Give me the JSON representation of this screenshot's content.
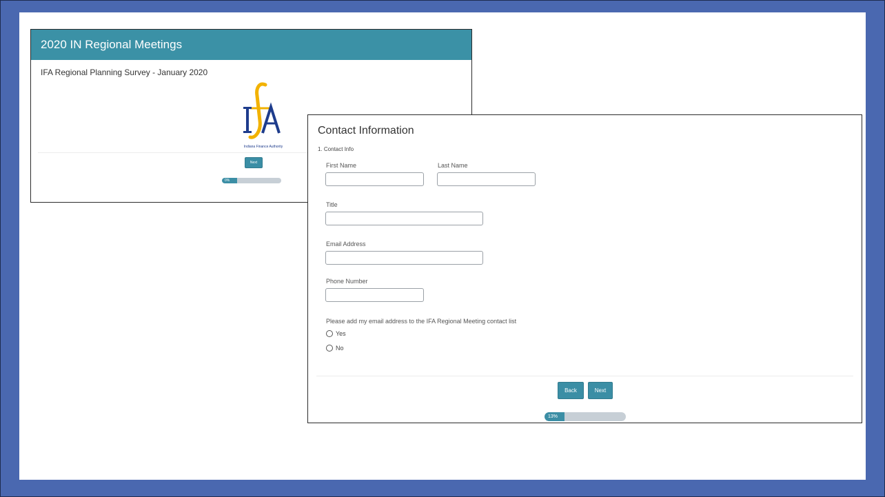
{
  "intro_window": {
    "header_title": "2020 IN Regional Meetings",
    "survey_title": "IFA Regional Planning Survey - January 2020",
    "logo": {
      "caption": "Indiana Finance Authority"
    },
    "next_label": "Next",
    "progress": {
      "label": "0%",
      "fraction": 0.0
    }
  },
  "contact_window": {
    "page_title": "Contact Information",
    "question_title": "1. Contact Info",
    "fields": {
      "first_name": {
        "label": "First Name",
        "value": ""
      },
      "last_name": {
        "label": "Last Name",
        "value": ""
      },
      "title": {
        "label": "Title",
        "value": ""
      },
      "email": {
        "label": "Email Address",
        "value": ""
      },
      "phone": {
        "label": "Phone Number",
        "value": ""
      }
    },
    "contact_list_question": "Please add my email address to the IFA Regional Meeting contact list",
    "options": [
      "Yes",
      "No"
    ],
    "back_label": "Back",
    "next_label": "Next",
    "progress": {
      "label": "13%",
      "fraction": 0.13
    }
  },
  "colors": {
    "background": "#4a68b0",
    "accent": "#3b8ea5",
    "header": "#3b91a6",
    "logo_gold": "#f2b200",
    "logo_blue": "#1e3c8c"
  }
}
